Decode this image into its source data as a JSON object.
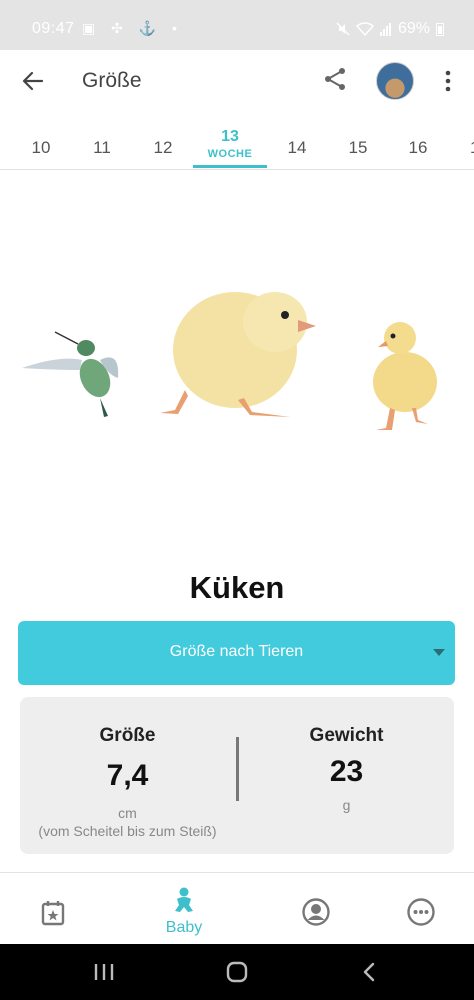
{
  "status_bar": {
    "time": "09:47",
    "left_icons": "▣ ✣ ⚓ •",
    "battery_text": "69%"
  },
  "app_bar": {
    "title": "Größe",
    "back_icon": "arrow-left-icon",
    "share_icon": "share-icon",
    "menu_icon": "more-vertical-icon"
  },
  "weeks": {
    "items": [
      "10",
      "11",
      "12",
      "13",
      "14",
      "15",
      "16",
      "1"
    ],
    "active": "13",
    "active_sub": "WOCHE"
  },
  "animal_name": "Küken",
  "dropdown": {
    "label": "Größe nach Tieren"
  },
  "stats": {
    "size": {
      "label": "Größe",
      "value": "7,4",
      "unit": "cm",
      "note": "(vom Scheitel bis zum Steiß)"
    },
    "weight": {
      "label": "Gewicht",
      "value": "23",
      "unit": "g"
    }
  },
  "bottom_nav": {
    "items": [
      {
        "icon": "calendar-star-icon",
        "label": ""
      },
      {
        "icon": "baby-icon",
        "label": "Baby"
      },
      {
        "icon": "mother-profile-icon",
        "label": ""
      },
      {
        "icon": "more-circle-icon",
        "label": ""
      }
    ]
  },
  "colors": {
    "accent": "#3ec0cc",
    "dropdown_bg": "#41cbdd",
    "card_bg": "#eeeeee",
    "status_bar_bg": "#e4e4e4"
  }
}
